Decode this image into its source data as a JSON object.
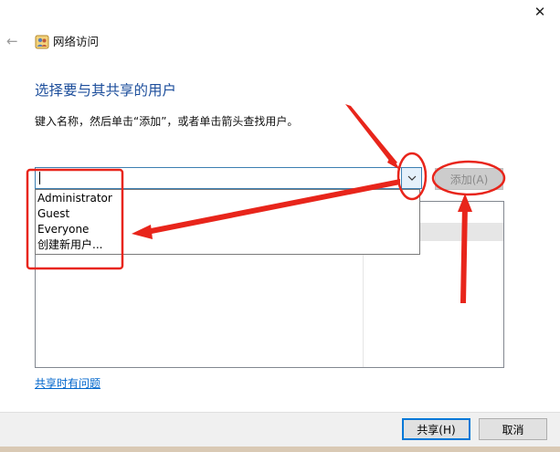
{
  "window": {
    "close_glyph": "✕",
    "back_glyph": "←",
    "wizard_title": "网络访问"
  },
  "main": {
    "heading": "选择要与其共享的用户",
    "instruction": "键入名称，然后单击“添加”，或者单击箭头查找用户。",
    "combo_value": "",
    "add_button": "添加(A)",
    "dropdown_items": [
      "Administrator",
      "Guest",
      "Everyone",
      "创建新用户..."
    ],
    "help_link": "共享时有问题"
  },
  "footer": {
    "share_button": "共享(H)",
    "cancel_button": "取消"
  },
  "icons": {
    "wizard": "network-users-icon",
    "dropdown": "chevron-down-icon"
  },
  "colors": {
    "heading": "#1e4f9c",
    "link": "#0066cc",
    "annotation": "#e8251b",
    "focus_border": "#3c7fb1"
  }
}
